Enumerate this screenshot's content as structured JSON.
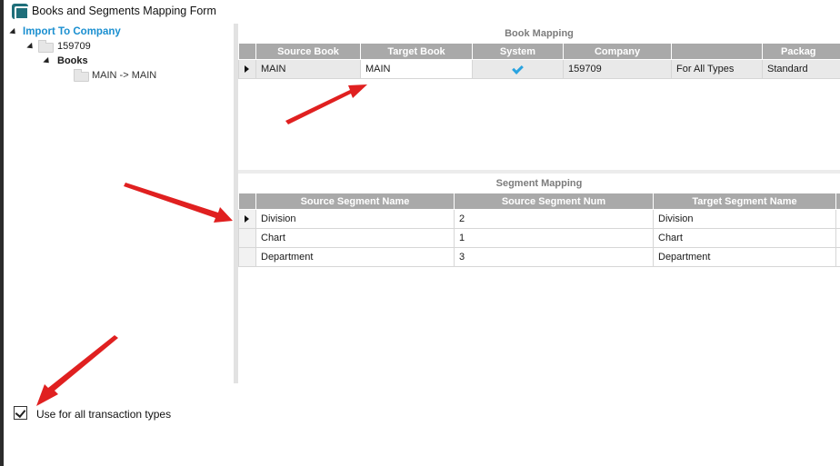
{
  "window": {
    "title": "Books and Segments Mapping Form",
    "icon": "app-logo-icon"
  },
  "tree": {
    "root": "Import To Company",
    "company": "159709",
    "books_node": "Books",
    "book_leaf": "MAIN -> MAIN"
  },
  "book_mapping": {
    "title": "Book Mapping",
    "columns": [
      "Source Book",
      "Target Book",
      "System",
      "Company",
      "",
      "Packag"
    ],
    "rows": [
      {
        "source_book": "MAIN",
        "target_book": "MAIN",
        "system": true,
        "company": "159709",
        "type": "For All Types",
        "package": "Standard"
      }
    ]
  },
  "segment_mapping": {
    "title": "Segment Mapping",
    "columns": [
      "Source Segment Name",
      "Source Segment Num",
      "Target Segment Name"
    ],
    "rows": [
      {
        "source_name": "Division",
        "source_num": "2",
        "target_name": "Division"
      },
      {
        "source_name": "Chart",
        "source_num": "1",
        "target_name": "Chart"
      },
      {
        "source_name": "Department",
        "source_num": "3",
        "target_name": "Department"
      }
    ]
  },
  "options": {
    "use_all_types_label": "Use for all transaction types",
    "use_all_types_checked": true
  },
  "colors": {
    "header_bg": "#a9a9a9",
    "tree_root": "#1a8fd0",
    "annotation_arrow": "#e02020",
    "check": "#29a3e0"
  }
}
